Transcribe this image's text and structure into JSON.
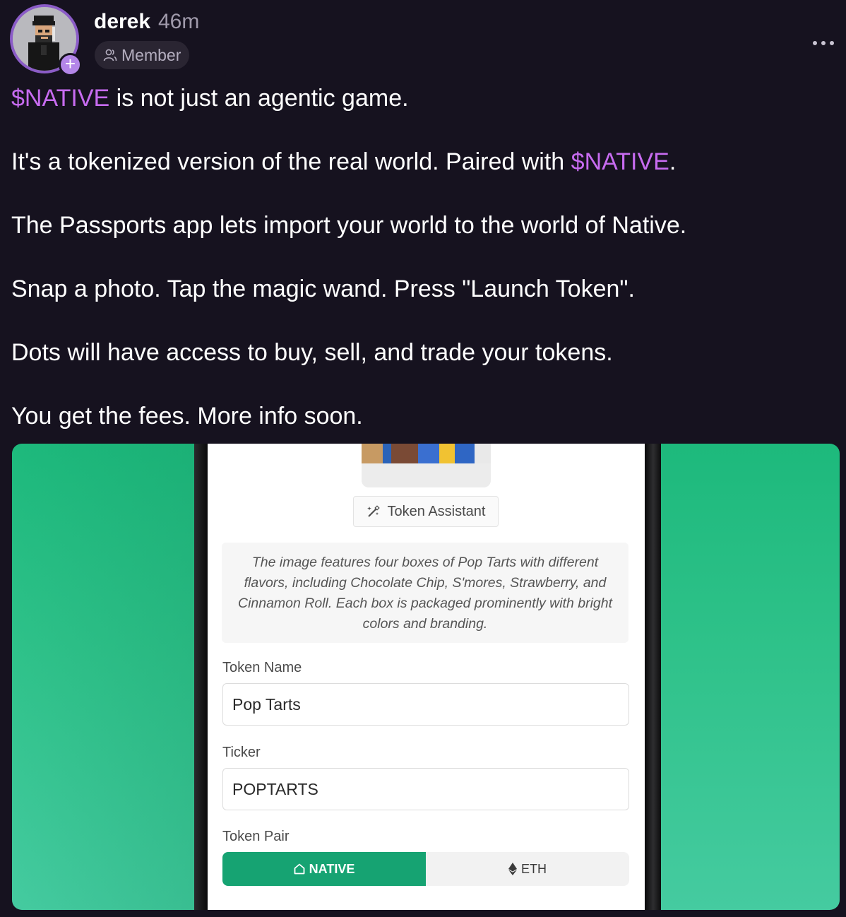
{
  "post": {
    "author": "derek",
    "time": "46m",
    "role": "Member",
    "lines": [
      {
        "segments": [
          {
            "text": "$NATIVE",
            "ticker": true
          },
          {
            "text": " is not just an agentic game."
          }
        ]
      },
      {
        "segments": [
          {
            "text": "It's a tokenized version of the real world. Paired with "
          },
          {
            "text": "$NATIVE",
            "ticker": true
          },
          {
            "text": "."
          }
        ]
      },
      {
        "segments": [
          {
            "text": "The Passports app lets import your world to the world of Native."
          }
        ]
      },
      {
        "segments": [
          {
            "text": "Snap a photo. Tap the magic wand. Press \"Launch Token\"."
          }
        ]
      },
      {
        "segments": [
          {
            "text": "Dots will have access to buy, sell, and trade your tokens."
          }
        ]
      },
      {
        "segments": [
          {
            "text": "You get the fees. More info soon."
          }
        ]
      }
    ]
  },
  "icons": {
    "role": "user-icon",
    "more": "more-horizontal-icon",
    "assistant": "magic-wand-icon",
    "native": "native-logo-icon",
    "eth": "ethereum-icon"
  },
  "colors": {
    "background": "#16121f",
    "ticker": "#c76bf0",
    "avatar_ring": "#8b5cc7",
    "media_green": "#1db97c",
    "native_green": "#16a372"
  },
  "app_screen": {
    "assistant_button": "Token Assistant",
    "description": "The image features four boxes of Pop Tarts with different flavors, including Chocolate Chip, S'mores, Strawberry, and Cinnamon Roll. Each box is packaged prominently with bright colors and branding.",
    "token_name_label": "Token Name",
    "token_name_value": "Pop Tarts",
    "ticker_label": "Ticker",
    "ticker_value": "POPTARTS",
    "token_pair_label": "Token Pair",
    "pair_options": [
      {
        "label": "NATIVE",
        "selected": true
      },
      {
        "label": "ETH",
        "selected": false
      }
    ]
  }
}
